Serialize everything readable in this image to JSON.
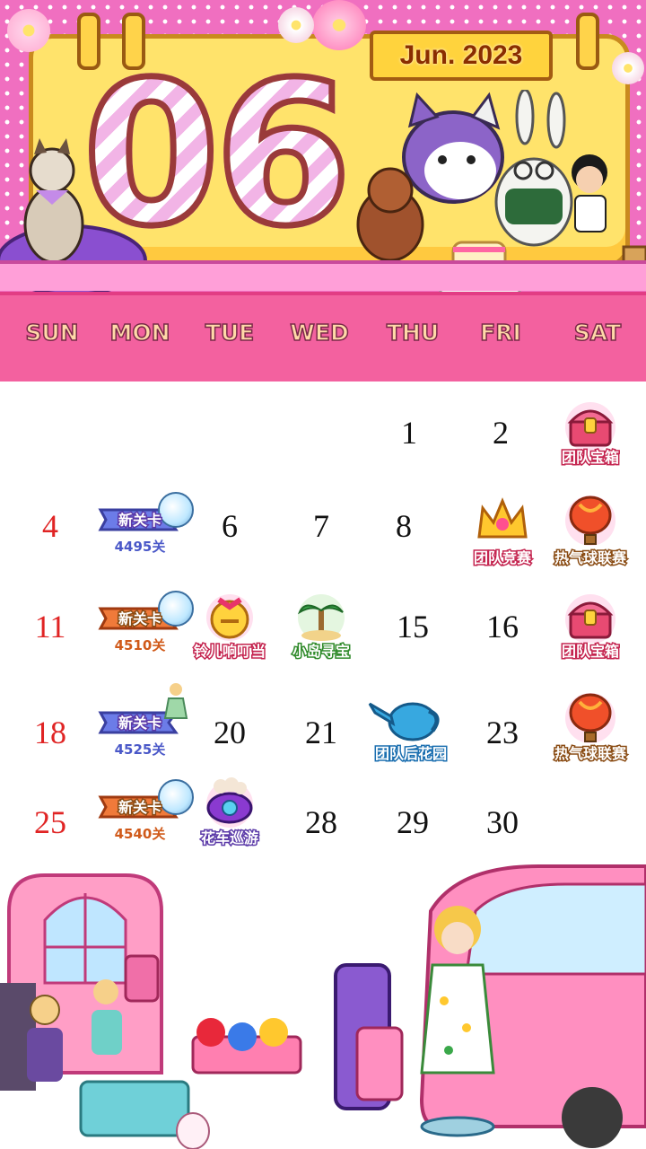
{
  "header": {
    "month_label": "Jun. 2023",
    "big_number": "06"
  },
  "weekdays": [
    "SUN",
    "MON",
    "TUE",
    "WED",
    "THU",
    "FRI",
    "SAT"
  ],
  "weeks": [
    {
      "sun": "",
      "mon": "",
      "tue": "",
      "wed": "",
      "thu": "1",
      "fri": "2"
    },
    {
      "sun": "4",
      "tue": "6",
      "wed": "7",
      "thu": "8"
    },
    {
      "sun": "11",
      "thu": "15",
      "fri": "16"
    },
    {
      "sun": "18",
      "tue": "20",
      "wed": "21",
      "fri": "23"
    },
    {
      "sun": "25",
      "wed": "28",
      "thu": "29",
      "fri": "30"
    }
  ],
  "events": {
    "team_chest": "团队宝箱",
    "team_race": "团队竞赛",
    "balloon_league": "热气球联赛",
    "bell": "铃儿响叮当",
    "island": "小岛寻宝",
    "team_garden": "团队后花园",
    "float_parade": "花车巡游",
    "new_level": "新关卡",
    "levels": [
      "4495关",
      "4510关",
      "4525关",
      "4540关"
    ]
  },
  "colors": {
    "header_pink": "#f06fc0",
    "weekday_bar": "#f3619f",
    "board_yellow": "#ffe36b",
    "sunday_red": "#e02424"
  }
}
